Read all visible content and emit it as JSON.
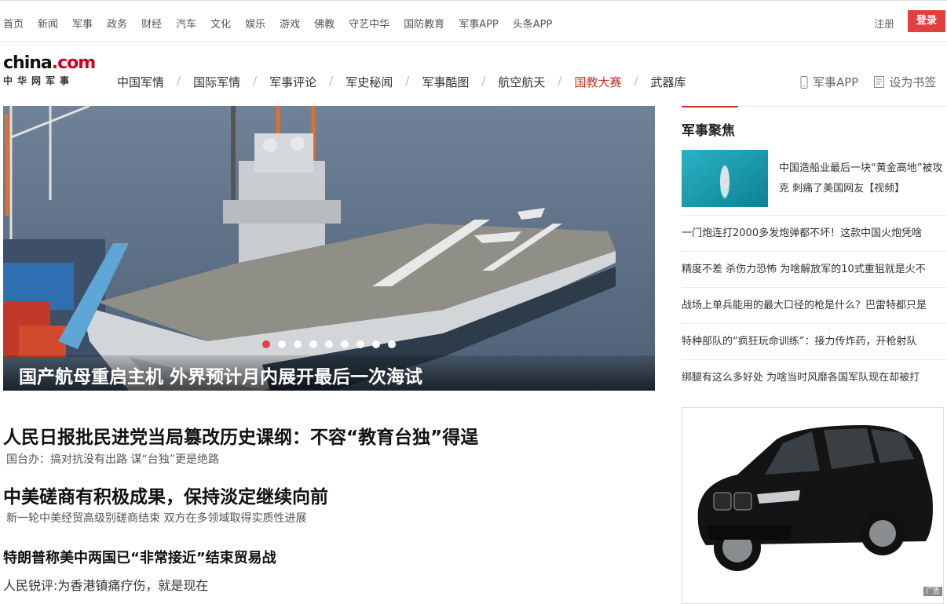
{
  "topbar": {
    "links": [
      "首页",
      "新闻",
      "军事",
      "政务",
      "财经",
      "汽车",
      "文化",
      "娱乐",
      "游戏",
      "佛教",
      "守艺中华",
      "国防教育",
      "军事APP",
      "头条APP"
    ],
    "register": "注册",
    "login": "登录"
  },
  "logo": {
    "main": "china",
    "dotcom": ".com",
    "sub": "中华网军事"
  },
  "mainnav": {
    "items": [
      "中国军情",
      "国际军情",
      "军事评论",
      "军史秘闻",
      "军事酷图",
      "航空航天",
      "国教大赛",
      "武器库"
    ],
    "separator": "/",
    "active_index": 6
  },
  "nav_right": {
    "app": "军事APP",
    "bookmark": "设为书签"
  },
  "hero": {
    "caption": "国产航母重启主机 外界预计月内展开最后一次海试",
    "slide_count": 9,
    "active_slide": 0
  },
  "headlines": {
    "h1_title": "人民日报批民进党当局篡改历史课纲：不容“教育台独”得逞",
    "h1_sub": "国台办：搞对抗没有出路 谋“台独”更是绝路",
    "h2_title": "中美磋商有积极成果，保持淡定继续向前",
    "h2_sub": "新一轮中美经贸高级别磋商结束 双方在多领域取得实质性进展",
    "h3_title": "特朗普称美中两国已“非常接近”结束贸易战",
    "h4_text": "人民锐评:为香港镇痛疗伤，就是现在"
  },
  "focus": {
    "title": "军事聚焦",
    "feature_text": "中国造船业最后一块“黄金高地”被攻克 刺痛了美国网友【视频】",
    "list": [
      "一门炮连打2000多发炮弹都不坏！这款中国火炮凭啥",
      "精度不差 杀伤力恐怖 为啥解放军的10式重狙就是火不",
      "战场上单兵能用的最大口径的枪是什么？巴雷特都只是",
      "特种部队的“疯狂玩命训练”：接力传炸药，开枪射队",
      "绑腿有这么多好处 为啥当时风靡各国军队现在却被打"
    ]
  },
  "ad": {
    "badge": "广告"
  },
  "colors": {
    "accent": "#c62f2f",
    "login_bg": "#e04040"
  },
  "icons": {
    "app": "phone-icon",
    "bookmark": "bookmark-icon"
  }
}
